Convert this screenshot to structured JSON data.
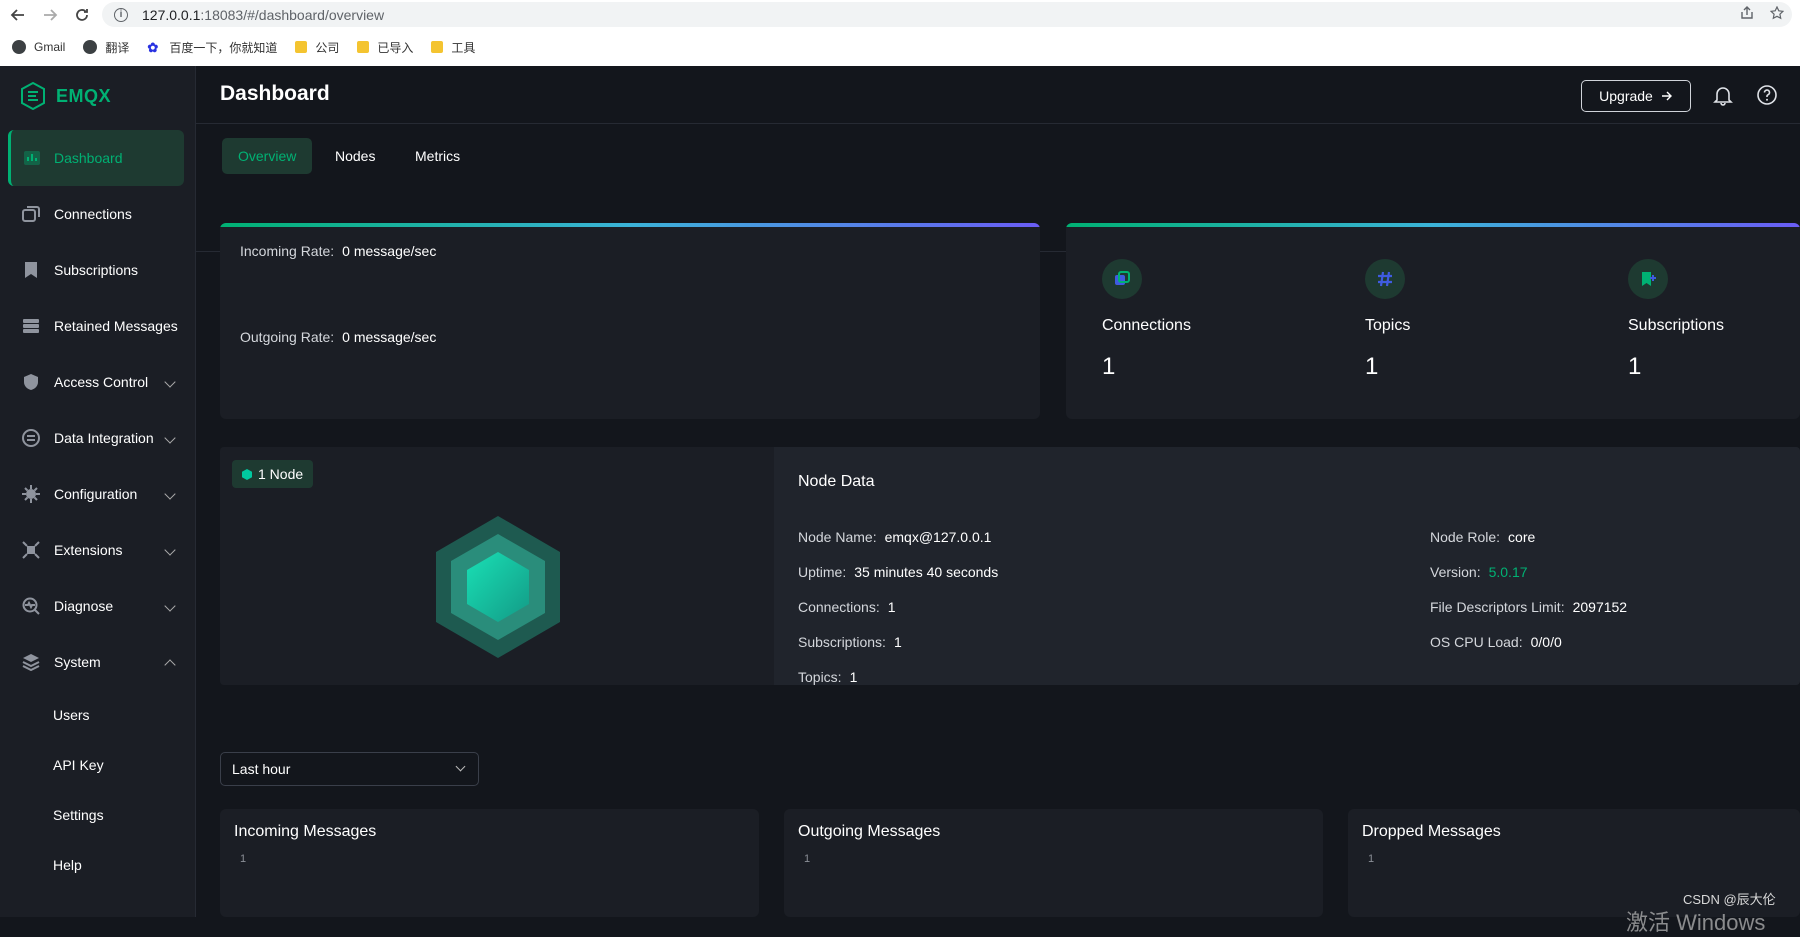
{
  "browser": {
    "url_host": "127.0.0.1",
    "url_path": ":18083/#/dashboard/overview",
    "bookmarks": [
      {
        "label": "Gmail",
        "icon": "globe-icon"
      },
      {
        "label": "翻译",
        "icon": "globe-icon"
      },
      {
        "label": "百度一下，你就知道",
        "icon": "baidu-icon"
      },
      {
        "label": "公司",
        "icon": "folder-icon"
      },
      {
        "label": "已导入",
        "icon": "folder-icon"
      },
      {
        "label": "工具",
        "icon": "folder-icon"
      }
    ]
  },
  "app": {
    "brand": "EMQX",
    "accent": "#00b173"
  },
  "sidebar": {
    "items": [
      {
        "label": "Dashboard",
        "icon": "dashboard-icon",
        "active": true
      },
      {
        "label": "Connections",
        "icon": "connections-icon"
      },
      {
        "label": "Subscriptions",
        "icon": "subscriptions-icon"
      },
      {
        "label": "Retained Messages",
        "icon": "retained-messages-icon"
      },
      {
        "label": "Access Control",
        "icon": "access-control-icon",
        "expandable": true
      },
      {
        "label": "Data Integration",
        "icon": "data-integration-icon",
        "expandable": true
      },
      {
        "label": "Configuration",
        "icon": "configuration-icon",
        "expandable": true
      },
      {
        "label": "Extensions",
        "icon": "extensions-icon",
        "expandable": true
      },
      {
        "label": "Diagnose",
        "icon": "diagnose-icon",
        "expandable": true
      },
      {
        "label": "System",
        "icon": "system-icon",
        "expanded": true
      }
    ],
    "system_children": [
      "Users",
      "API Key",
      "Settings",
      "Help"
    ]
  },
  "header": {
    "title": "Dashboard",
    "upgrade_label": "Upgrade"
  },
  "tabs": [
    {
      "label": "Overview",
      "active": true
    },
    {
      "label": "Nodes"
    },
    {
      "label": "Metrics"
    }
  ],
  "rates": {
    "incoming_label": "Incoming Rate:",
    "incoming_value": "0 message/sec",
    "outgoing_label": "Outgoing Rate:",
    "outgoing_value": "0 message/sec"
  },
  "stats": [
    {
      "label": "Connections",
      "value": "1",
      "icon": "connections-stat-icon"
    },
    {
      "label": "Topics",
      "value": "1",
      "icon": "hash-icon"
    },
    {
      "label": "Subscriptions",
      "value": "1",
      "icon": "subscriptions-stat-icon"
    }
  ],
  "node": {
    "badge": "1 Node",
    "title": "Node Data",
    "left": [
      {
        "k": "Node Name:",
        "v": "emqx@127.0.0.1"
      },
      {
        "k": "Uptime:",
        "v": "35 minutes 40 seconds"
      },
      {
        "k": "Connections:",
        "v": "1"
      },
      {
        "k": "Subscriptions:",
        "v": "1"
      },
      {
        "k": "Topics:",
        "v": "1"
      }
    ],
    "right": [
      {
        "k": "Node Role:",
        "v": "core"
      },
      {
        "k": "Version:",
        "v": "5.0.17"
      },
      {
        "k": "File Descriptors Limit:",
        "v": "2097152"
      },
      {
        "k": "OS CPU Load:",
        "v": "0/0/0"
      }
    ]
  },
  "time_range": {
    "selected": "Last hour"
  },
  "metrics": [
    {
      "title": "Incoming Messages",
      "tick": "1"
    },
    {
      "title": "Outgoing Messages",
      "tick": "1"
    },
    {
      "title": "Dropped Messages",
      "tick": "1"
    }
  ],
  "watermark": {
    "csdn": "CSDN @辰大伦",
    "windows": "激活 Windows"
  }
}
